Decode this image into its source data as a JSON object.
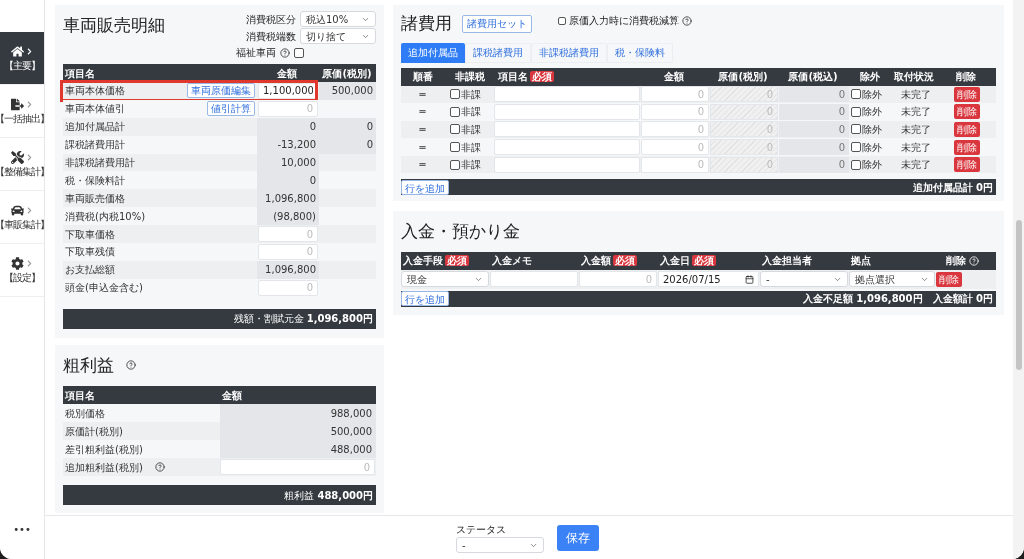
{
  "sidebar": {
    "items": [
      {
        "label": "【主要】",
        "selected": true
      },
      {
        "label": "【一括抽出】",
        "selected": false
      },
      {
        "label": "【整備集計】",
        "selected": false
      },
      {
        "label": "【車販集計】",
        "selected": false
      },
      {
        "label": "【設定】",
        "selected": false
      }
    ],
    "more": "•••"
  },
  "sales": {
    "title": "車両販売明細",
    "tax_fields": [
      {
        "label": "消費税区分",
        "value": "税込10%"
      },
      {
        "label": "消費税端数",
        "value": "切り捨て"
      }
    ],
    "welfare": {
      "label": "福祉車両",
      "checked": false
    },
    "columns": [
      "項目名",
      "金額",
      "原価(税別)"
    ],
    "rows": [
      {
        "name": "車両本体価格",
        "button": "車両原価編集",
        "kind": "input",
        "value": "1,100,000",
        "cost": "500,000",
        "highlighted": true
      },
      {
        "name": "車両本体値引",
        "button": "値引計算",
        "kind": "input",
        "placeholder": "0",
        "highlighted": false
      },
      {
        "name": "追加付属品計",
        "kind": "readonly",
        "value": "0",
        "cost": "0",
        "highlighted": false
      },
      {
        "name": "課税諸費用計",
        "kind": "readonly",
        "value": "-13,200",
        "cost": "0",
        "highlighted": false
      },
      {
        "name": "非課税諸費用計",
        "kind": "readonly",
        "value": "10,000",
        "highlighted": false
      },
      {
        "name": "税・保険料計",
        "kind": "readonly",
        "value": "0",
        "highlighted": false
      },
      {
        "name": "車両販売価格",
        "kind": "readonly",
        "value": "1,096,800",
        "highlighted": false
      },
      {
        "name": "消費税(内税10%)",
        "kind": "readonly",
        "value": "(98,800)",
        "highlighted": false
      },
      {
        "name": "下取車価格",
        "kind": "input",
        "placeholder": "0",
        "highlighted": false
      },
      {
        "name": "下取車残債",
        "kind": "input",
        "placeholder": "0",
        "highlighted": false
      },
      {
        "name": "お支払総額",
        "kind": "readonly",
        "value": "1,096,800",
        "highlighted": false
      },
      {
        "name": "頭金(申込金含む)",
        "kind": "input",
        "placeholder": "0",
        "highlighted": false
      }
    ],
    "total": "残額・割賦元金 **1,096,800円**"
  },
  "profit": {
    "title": "粗利益",
    "columns": [
      "項目名",
      "金額"
    ],
    "rows": [
      {
        "name": "税別価格",
        "kind": "readonly",
        "value": "988,000",
        "help": false
      },
      {
        "name": "原価計(税別)",
        "kind": "readonly",
        "value": "500,000",
        "help": false
      },
      {
        "name": "差引粗利益(税別)",
        "kind": "readonly",
        "value": "488,000",
        "help": false
      },
      {
        "name": "追加粗利益(税別)",
        "kind": "input",
        "placeholder": "0",
        "help": true
      }
    ],
    "total": "粗利益 **488,000円**"
  },
  "expenses": {
    "title": "諸費用",
    "set_button": "諸費用セット",
    "option": {
      "label": "原価入力時に消費税減算",
      "checked": false
    },
    "tabs": [
      {
        "label": "追加付属品",
        "selected": true
      },
      {
        "label": "課税諸費用",
        "selected": false
      },
      {
        "label": "非課税諸費用",
        "selected": false
      },
      {
        "label": "税・保険料",
        "selected": false
      }
    ],
    "columns": [
      {
        "label": "順番"
      },
      {
        "label": "非課税"
      },
      {
        "label": "項目名",
        "required": "必須"
      },
      {
        "label": "金額"
      },
      {
        "label": "原価(税別)"
      },
      {
        "label": "原価(税込)"
      },
      {
        "label": "除外"
      },
      {
        "label": "取付状況"
      },
      {
        "label": "削除"
      }
    ],
    "rows": [
      {
        "order": "═",
        "nontax": {
          "label": "非課",
          "checked": false
        },
        "amount": {
          "placeholder": "0"
        },
        "cost_ex": {
          "placeholder": "0"
        },
        "cost_in": {
          "placeholder": "0"
        },
        "exclude": {
          "label": "除外",
          "checked": false
        },
        "status": "未完了",
        "delete": "削除"
      },
      {
        "order": "═",
        "nontax": {
          "label": "非課",
          "checked": false
        },
        "amount": {
          "placeholder": "0"
        },
        "cost_ex": {
          "placeholder": "0"
        },
        "cost_in": {
          "placeholder": "0"
        },
        "exclude": {
          "label": "除外",
          "checked": false
        },
        "status": "未完了",
        "delete": "削除"
      },
      {
        "order": "═",
        "nontax": {
          "label": "非課",
          "checked": false
        },
        "amount": {
          "placeholder": "0"
        },
        "cost_ex": {
          "placeholder": "0"
        },
        "cost_in": {
          "placeholder": "0"
        },
        "exclude": {
          "label": "除外",
          "checked": false
        },
        "status": "未完了",
        "delete": "削除"
      },
      {
        "order": "═",
        "nontax": {
          "label": "非課",
          "checked": false
        },
        "amount": {
          "placeholder": "0"
        },
        "cost_ex": {
          "placeholder": "0"
        },
        "cost_in": {
          "placeholder": "0"
        },
        "exclude": {
          "label": "除外",
          "checked": false
        },
        "status": "未完了",
        "delete": "削除"
      },
      {
        "order": "═",
        "nontax": {
          "label": "非課",
          "checked": false
        },
        "amount": {
          "placeholder": "0"
        },
        "cost_ex": {
          "placeholder": "0"
        },
        "cost_in": {
          "placeholder": "0"
        },
        "exclude": {
          "label": "除外",
          "checked": false
        },
        "status": "未完了",
        "delete": "削除"
      }
    ],
    "add_row": "行を追加",
    "total": "追加付属品計 0円"
  },
  "payments": {
    "title": "入金・預かり金",
    "columns": [
      {
        "label": "入金手段",
        "required": "必須"
      },
      {
        "label": "入金メモ"
      },
      {
        "label": "入金額",
        "required": "必須"
      },
      {
        "label": "入金日",
        "required": "必須"
      },
      {
        "label": "入金担当者"
      },
      {
        "label": "拠点"
      },
      {
        "label": "削除",
        "help": true
      }
    ],
    "rows": [
      {
        "method": "現金",
        "amount": {
          "placeholder": "0"
        },
        "date": "2026/07/15",
        "staff": "-",
        "base": "拠点選択",
        "delete": "削除"
      }
    ],
    "add_row": "行を追加",
    "shortage": "入金不足額 1,096,800円",
    "total": "入金額計 0円"
  },
  "footer": {
    "status_label": "ステータス",
    "status_value": "-",
    "save": "保存"
  }
}
